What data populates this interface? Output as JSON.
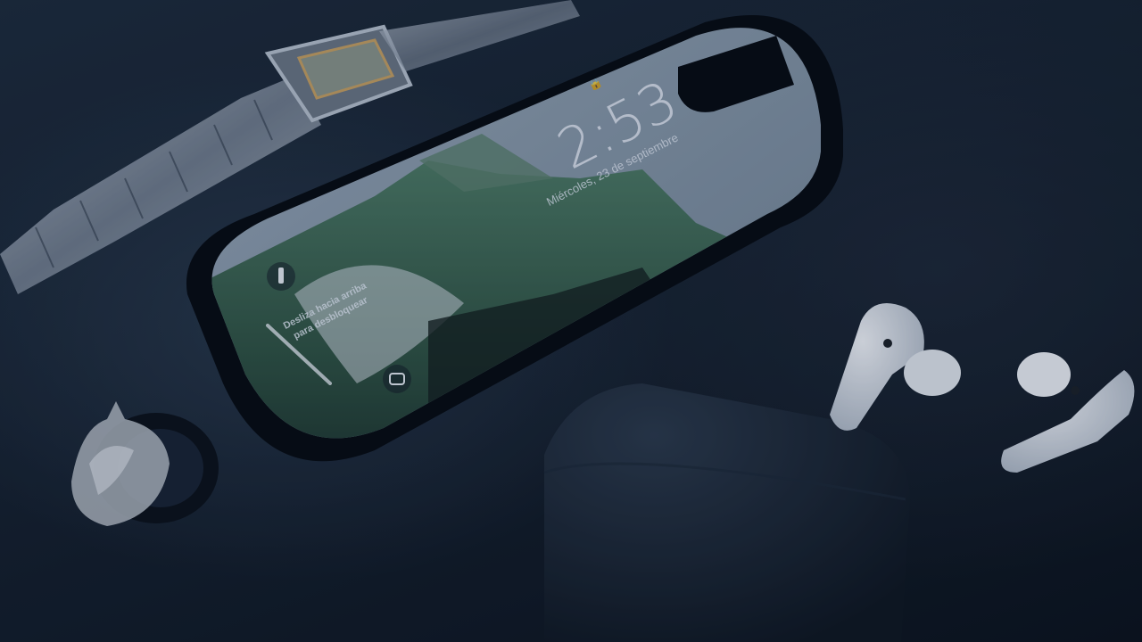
{
  "photo": {
    "subject": "phone-watch-earbuds-flatlay",
    "icons": [
      "lock-icon",
      "flashlight-icon",
      "camera-icon"
    ]
  },
  "lockscreen": {
    "time": "2:53",
    "date": "Miércoles, 23 de septiembre",
    "slide_hint_line1": "Desliza hacia arriba",
    "slide_hint_line2": "para desbloquear"
  },
  "colors": {
    "background": "#121b26",
    "accent_mountain": "#3f6a55",
    "earbud": "#e9edf2"
  }
}
